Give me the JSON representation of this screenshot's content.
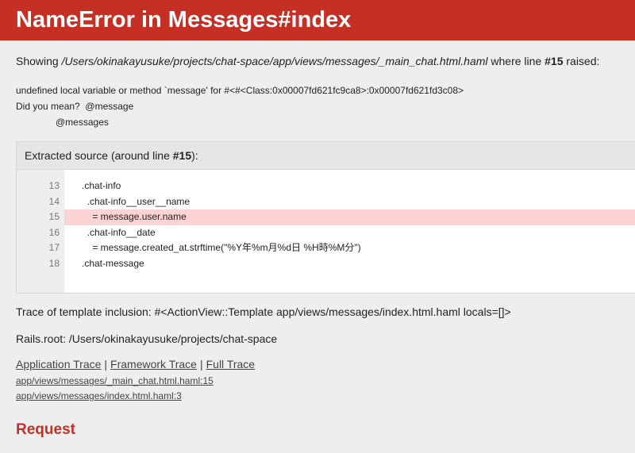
{
  "header": {
    "title": "NameError in Messages#index"
  },
  "showing": {
    "prefix": "Showing",
    "path": "/Users/okinakayusuke/projects/chat-space/app/views/messages/_main_chat.html.haml",
    "mid": "where line",
    "line": "#15",
    "suffix": "raised:"
  },
  "error": {
    "message": "undefined local variable or method `message' for #<#<Class:0x00007fd621fc9ca8>:0x00007fd621fd3c08>",
    "suggest_label": "Did you mean?",
    "suggest_1": "@message",
    "suggest_2": "@messages"
  },
  "source": {
    "heading_prefix": "Extracted source (around line",
    "heading_line": "#15",
    "heading_suffix": "):",
    "highlight_line": 15,
    "lines": [
      {
        "num": "13",
        "code": ".chat-info"
      },
      {
        "num": "14",
        "code": "  .chat-info__user__name"
      },
      {
        "num": "15",
        "code": "    = message.user.name"
      },
      {
        "num": "16",
        "code": "  .chat-info__date"
      },
      {
        "num": "17",
        "code": "    = message.created_at.strftime(\"%Y年%m月%d日 %H時%M分\")"
      },
      {
        "num": "18",
        "code": ".chat-message"
      }
    ]
  },
  "trace_inclusion": "Trace of template inclusion: #<ActionView::Template app/views/messages/index.html.haml locals=[]>",
  "rails_root": "Rails.root: /Users/okinakayusuke/projects/chat-space",
  "trace_tabs": {
    "application": "Application Trace",
    "framework": "Framework Trace",
    "full": "Full Trace",
    "separator": "|"
  },
  "trace_entries": [
    "app/views/messages/_main_chat.html.haml:15",
    "app/views/messages/index.html.haml:3"
  ],
  "request_heading": "Request",
  "colors": {
    "accent": "#c52f24",
    "highlight": "#fcd3d3"
  }
}
